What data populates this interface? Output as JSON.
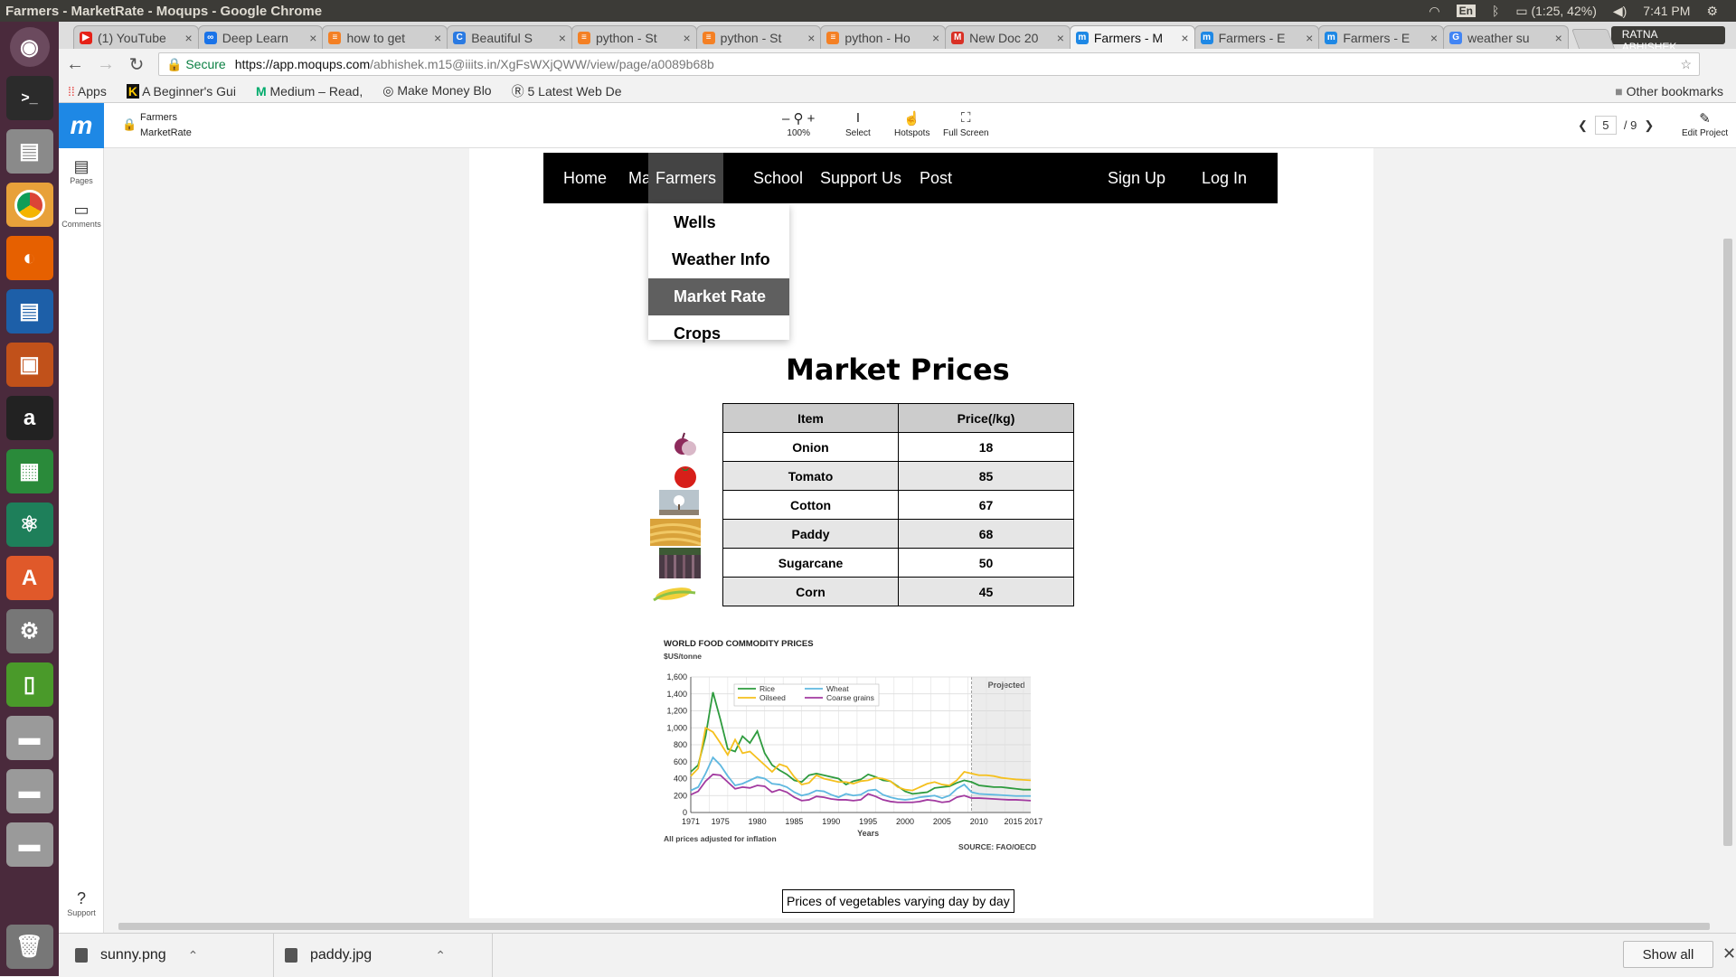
{
  "os": {
    "window_title": "Farmers - MarketRate - Moqups - Google Chrome",
    "lang": "En",
    "battery": "(1:25, 42%)",
    "time": "7:41 PM"
  },
  "browser": {
    "tabs": [
      {
        "label": "(1) YouTube",
        "color": "#e62117",
        "glyph": "▶"
      },
      {
        "label": "Deep Learn",
        "color": "#1a73e8",
        "glyph": "∞"
      },
      {
        "label": "how to get",
        "color": "#f48024",
        "glyph": "≡"
      },
      {
        "label": "Beautiful S",
        "color": "#2a7ae2",
        "glyph": "C"
      },
      {
        "label": "python - St",
        "color": "#f48024",
        "glyph": "≡"
      },
      {
        "label": "python - St",
        "color": "#f48024",
        "glyph": "≡"
      },
      {
        "label": "python - Ho",
        "color": "#f48024",
        "glyph": "≡"
      },
      {
        "label": "New Doc 20",
        "color": "#d93025",
        "glyph": "M"
      },
      {
        "label": "Farmers - M",
        "color": "#1e88e5",
        "glyph": "m"
      },
      {
        "label": "Farmers - E",
        "color": "#1e88e5",
        "glyph": "m"
      },
      {
        "label": "Farmers - E",
        "color": "#1e88e5",
        "glyph": "m"
      },
      {
        "label": "weather su",
        "color": "#4285f4",
        "glyph": "G"
      }
    ],
    "user": "RATNA ABHISHEK",
    "secure_label": "Secure",
    "url_host": "https://app.moqups.com",
    "url_path": "/abhishek.m15@iiits.in/XgFsWXjQWW/view/page/a0089b68b",
    "bookmarks": [
      "Apps",
      "A Beginner's Gui",
      "Medium – Read, ",
      "Make Money Blo",
      "5 Latest Web De"
    ],
    "other_bookmarks": "Other bookmarks"
  },
  "moqups": {
    "project_line1": "Farmers",
    "project_line2": "MarketRate",
    "tools": {
      "zoom": "100%",
      "select": "Select",
      "hotspots": "Hotspots",
      "fullscreen": "Full Screen",
      "edit": "Edit Project"
    },
    "page_current": "5",
    "page_total": "/ 9",
    "sidebar": {
      "pages": "Pages",
      "comments": "Comments",
      "support": "Support"
    }
  },
  "site": {
    "nav": {
      "home": "Home",
      "map": "Map",
      "farmers": "Farmers",
      "school": "School",
      "support": "Support Us",
      "post": "Post",
      "signup": "Sign Up",
      "login": "Log In"
    },
    "dropdown": [
      "Wells",
      "Weather Info",
      "Market Rate",
      "Crops"
    ],
    "title": "Market Prices",
    "table": {
      "headers": [
        "Item",
        "Price(/kg)"
      ],
      "rows": [
        {
          "item": "Onion",
          "price": "18"
        },
        {
          "item": "Tomato",
          "price": "85"
        },
        {
          "item": "Cotton",
          "price": "67"
        },
        {
          "item": "Paddy",
          "price": "68"
        },
        {
          "item": "Sugarcane",
          "price": "50"
        },
        {
          "item": "Corn",
          "price": "45"
        }
      ]
    },
    "caption": "Prices of vegetables varying day by day"
  },
  "chart_data": {
    "type": "line",
    "title": "WORLD FOOD COMMODITY PRICES",
    "ylabel": "$US/tonne",
    "xlabel": "Years",
    "note": "All prices adjusted for inflation",
    "source": "SOURCE: FAO/OECD",
    "projected_label": "Projected",
    "x_ticks": [
      "1971",
      "1975",
      "1980",
      "1985",
      "1990",
      "1995",
      "2000",
      "2005",
      "2010",
      "2015 2017"
    ],
    "y_ticks": [
      "0",
      "200",
      "400",
      "600",
      "800",
      "1,000",
      "1,200",
      "1,400",
      "1,600"
    ],
    "ylim": [
      0,
      1600
    ],
    "xlim": [
      1971,
      2017
    ],
    "projected_from": 2009,
    "x": [
      1971,
      1972,
      1973,
      1974,
      1975,
      1976,
      1977,
      1978,
      1979,
      1980,
      1981,
      1982,
      1983,
      1984,
      1985,
      1986,
      1987,
      1988,
      1989,
      1990,
      1991,
      1992,
      1993,
      1994,
      1995,
      1996,
      1997,
      1998,
      1999,
      2000,
      2001,
      2002,
      2003,
      2004,
      2005,
      2006,
      2007,
      2008,
      2009,
      2010,
      2011,
      2012,
      2013,
      2014,
      2015,
      2016,
      2017
    ],
    "series": [
      {
        "name": "Rice",
        "color": "#2e9b3e",
        "values": [
          480,
          560,
          900,
          1420,
          1100,
          750,
          720,
          900,
          820,
          960,
          700,
          560,
          500,
          450,
          380,
          360,
          440,
          460,
          440,
          420,
          400,
          330,
          370,
          390,
          450,
          420,
          380,
          370,
          310,
          250,
          220,
          230,
          240,
          290,
          300,
          310,
          350,
          380,
          360,
          320,
          310,
          300,
          300,
          290,
          280,
          270,
          270
        ]
      },
      {
        "name": "Oilseed",
        "color": "#f5c01e",
        "values": [
          430,
          520,
          1000,
          950,
          820,
          680,
          860,
          700,
          720,
          640,
          560,
          480,
          570,
          540,
          420,
          330,
          350,
          440,
          400,
          380,
          360,
          360,
          340,
          370,
          380,
          410,
          400,
          370,
          300,
          270,
          260,
          300,
          340,
          360,
          330,
          320,
          380,
          480,
          460,
          440,
          440,
          430,
          410,
          400,
          390,
          385,
          380
        ]
      },
      {
        "name": "Wheat",
        "color": "#5fb8e0",
        "values": [
          260,
          300,
          460,
          650,
          560,
          430,
          320,
          340,
          380,
          420,
          400,
          340,
          330,
          300,
          240,
          200,
          220,
          260,
          250,
          210,
          180,
          220,
          200,
          210,
          260,
          270,
          210,
          180,
          160,
          150,
          160,
          180,
          190,
          200,
          170,
          200,
          280,
          330,
          240,
          220,
          215,
          210,
          205,
          200,
          195,
          195,
          195
        ]
      },
      {
        "name": "Coarse grains",
        "color": "#a23aa0",
        "values": [
          210,
          250,
          370,
          450,
          440,
          360,
          280,
          300,
          290,
          320,
          310,
          240,
          270,
          240,
          180,
          140,
          150,
          190,
          180,
          160,
          150,
          150,
          140,
          150,
          220,
          190,
          150,
          130,
          120,
          120,
          120,
          130,
          150,
          140,
          120,
          130,
          180,
          200,
          170,
          170,
          165,
          160,
          155,
          150,
          150,
          145,
          140
        ]
      }
    ]
  }
}
